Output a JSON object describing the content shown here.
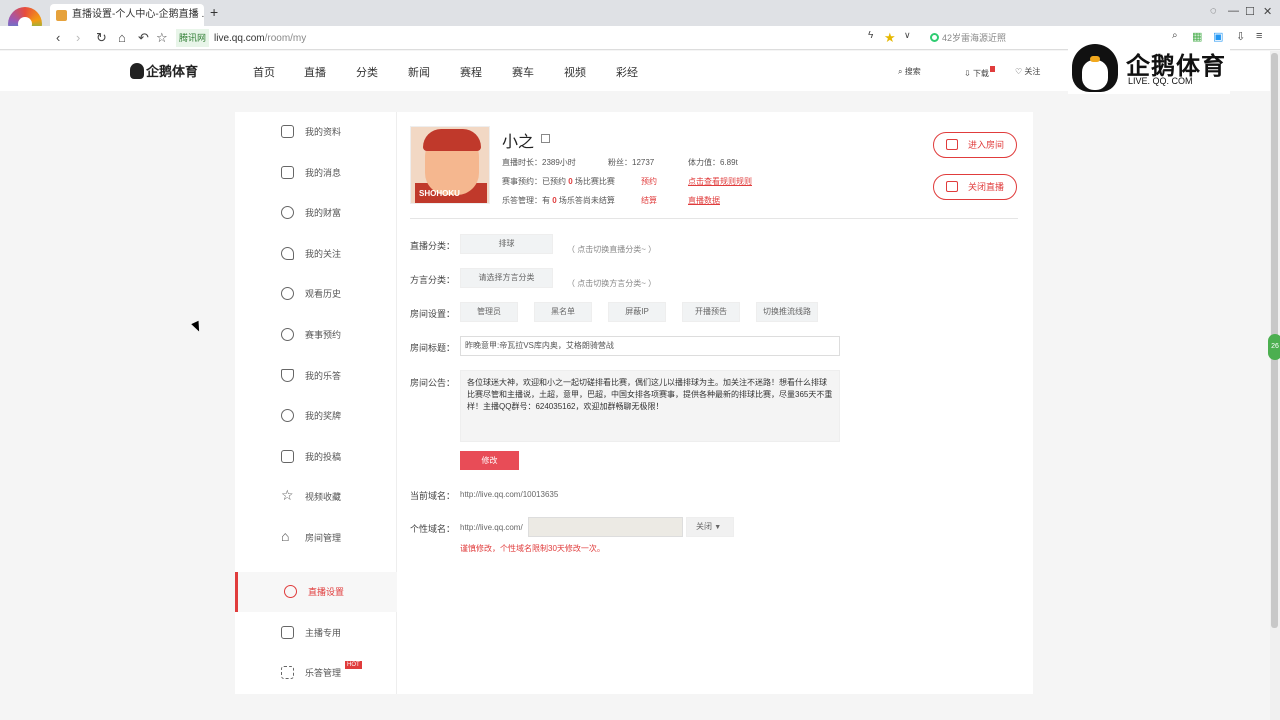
{
  "browser": {
    "tab_title": "直播设置-个人中心-企鹅直播 ...",
    "tab_close": "×",
    "new_tab": "+",
    "secure_label": "腾讯网",
    "url_host": "live.qq.com",
    "url_path": "/room/my",
    "search_text": "42岁雷海源近照"
  },
  "site": {
    "brand": "企鹅体育",
    "nav": [
      "首页",
      "直播",
      "分类",
      "新闻",
      "赛程",
      "赛车",
      "视频",
      "彩经"
    ],
    "search_label": "搜索",
    "download_label": "下载",
    "follow_label": "关注",
    "big_logo_title": "企鹅体育",
    "big_logo_sub": "LIVE. QQ. COM"
  },
  "sidebar": {
    "items": [
      {
        "label": "我的资料",
        "icon": "user-icon"
      },
      {
        "label": "我的消息",
        "icon": "mail-icon"
      },
      {
        "label": "我的财富",
        "icon": "yen-icon"
      },
      {
        "label": "我的关注",
        "icon": "heart-icon"
      },
      {
        "label": "观看历史",
        "icon": "clock-icon"
      },
      {
        "label": "赛事预约",
        "icon": "alarm-icon"
      },
      {
        "label": "我的乐答",
        "icon": "trophy-icon"
      },
      {
        "label": "我的奖牌",
        "icon": "medal-icon"
      },
      {
        "label": "我的投稿",
        "icon": "video-icon"
      },
      {
        "label": "视频收藏",
        "icon": "star-icon"
      },
      {
        "label": "房间管理",
        "icon": "home-icon"
      },
      {
        "label": "直播设置",
        "icon": "gear-icon"
      },
      {
        "label": "主播专用",
        "icon": "anchor-icon"
      },
      {
        "label": "乐答管理",
        "icon": "grid-icon"
      }
    ],
    "hot_badge": "HOT"
  },
  "profile": {
    "name": "小之",
    "jersey_text": "SHOHOKU",
    "live_duration": "直播时长：2389小时",
    "fans": "粉丝：12737",
    "stamina": "体力值：6.89t",
    "reservation_prefix": "赛事预约：已预约",
    "reservation_count": "0",
    "reservation_suffix": "场比赛比赛",
    "reserve_link": "预约",
    "reserve_rule_link": "点击查看规则规则",
    "ledan_prefix": "乐答管理：有",
    "ledan_count": "0",
    "ledan_suffix": "场乐答尚未结算",
    "settle_link": "结算",
    "live_data_link": "直播数据"
  },
  "actions": {
    "enter_room": "进入房间",
    "close_live": "关闭直播"
  },
  "settings": {
    "category_label": "直播分类：",
    "category_value": "排球",
    "category_hint": "（ 点击切换直播分类~ ）",
    "dialect_label": "方言分类：",
    "dialect_value": "请选择方言分类",
    "dialect_hint": "（ 点击切换方言分类~ ）",
    "room_settings_label": "房间设置：",
    "room_buttons": [
      "管理员",
      "黑名单",
      "屏蔽IP",
      "开播预告",
      "切换推流线路"
    ],
    "room_title_label": "房间标题：",
    "room_title_value": "昨晚意甲:帝瓦拉VS库内奥，艾格朗骑营战",
    "notice_label": "房间公告：",
    "notice_value": "各位球迷大神，欢迎和小之一起切磋排看比赛，偶们这儿以播排球为主。加关注不迷路！想看什么排球比赛尽管和主播说，土超，意甲，巴超，中国女排各项赛事，提供各种最新的排球比赛，尽量365天不重样！主播QQ群号：624035162，欢迎加群畅聊无极限！",
    "modify_button": "修改",
    "current_domain_label": "当前域名：",
    "current_domain_value": "http://live.qq.com/10013635",
    "custom_domain_label": "个性域名：",
    "custom_domain_prefix": "http://live.qq.com/",
    "custom_domain_option": "关闭",
    "domain_warning": "谨慎修改，个性域名限制30天修改一次。"
  }
}
